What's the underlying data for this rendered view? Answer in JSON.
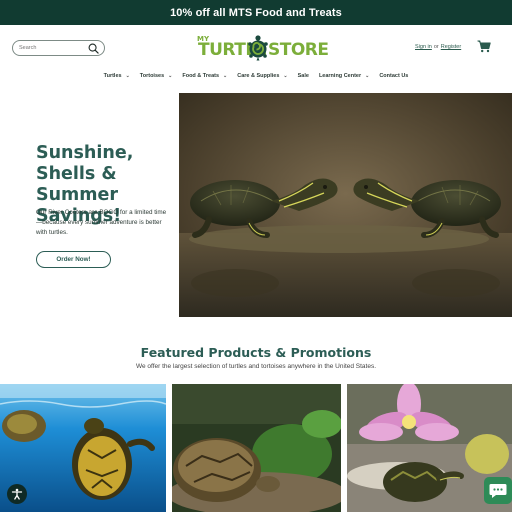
{
  "promo_bar": {
    "text": "10% off all MTS Food and Treats"
  },
  "header": {
    "search_placeholder": "Search",
    "logo": {
      "my": "MY",
      "turtle": "TURTLE",
      "store": "STORE"
    },
    "account": {
      "sign_in": "Sign in",
      "or": "or",
      "register": "Register"
    }
  },
  "nav": {
    "items": [
      {
        "label": "Turtles",
        "dropdown": "⌄"
      },
      {
        "label": "Tortoises",
        "dropdown": "⌄"
      },
      {
        "label": "Food & Treats",
        "dropdown": "⌄"
      },
      {
        "label": "Care & Supplies",
        "dropdown": "⌄"
      },
      {
        "label": "Sale",
        "dropdown": ""
      },
      {
        "label": "Learning Center",
        "dropdown": "⌄"
      },
      {
        "label": "Contact Us",
        "dropdown": ""
      }
    ]
  },
  "hero": {
    "title": "Sunshine, Shells & Summer Savings!",
    "text": "Our River Cooters are BOGO for a limited time—because every summer adventure is better with turtles.",
    "button": "Order Now!"
  },
  "featured": {
    "title": "Featured Products & Promotions",
    "subtitle": "We offer the largest selection of turtles and tortoises anywhere in the United States."
  },
  "colors": {
    "promo_bg": "#113b31",
    "brand_green": "#7cae3a",
    "heading_teal": "#2c5d55",
    "chat_green": "#2e8b57"
  },
  "icons": {
    "search": "search-icon",
    "cart": "cart-icon",
    "accessibility": "accessibility-icon",
    "chat": "chat-icon"
  }
}
